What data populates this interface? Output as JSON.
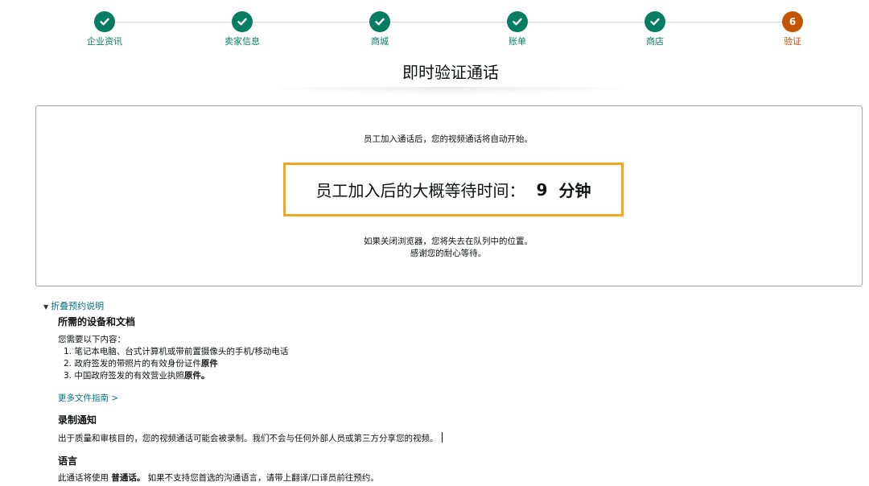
{
  "stepper": {
    "steps": [
      {
        "label": "企业资讯",
        "state": "done"
      },
      {
        "label": "卖家信息",
        "state": "done"
      },
      {
        "label": "商城",
        "state": "done"
      },
      {
        "label": "账单",
        "state": "done"
      },
      {
        "label": "商店",
        "state": "done"
      },
      {
        "label": "验证",
        "state": "current",
        "number": "6"
      }
    ]
  },
  "page_title": "即时验证通话",
  "wait_box": {
    "auto_start_text": "员工加入通话后，您的视频通话将自动开始。",
    "wait_label": "员工加入后的大概等待时间：",
    "wait_minutes": "9",
    "wait_unit": "分钟",
    "note_line1": "如果关闭浏览器，您将失去在队列中的位置。",
    "note_line2": "感谢您的耐心等待。"
  },
  "instructions": {
    "toggle_label": "折叠预约说明",
    "equipment": {
      "heading": "所需的设备和文档",
      "intro": "您需要以下内容：",
      "items": [
        {
          "text": "1. 笔记本电脑、台式计算机或带前置摄像头的手机/移动电话",
          "bold": ""
        },
        {
          "text": "2. 政府签发的带照片的有效身份证件",
          "bold": "原件"
        },
        {
          "text": "3. 中国政府签发的有效营业执照",
          "bold": "原件。"
        }
      ],
      "more_link": "更多文件指南 >"
    },
    "recording": {
      "heading": "录制通知",
      "text": "出于质量和审核目的，您的视频通话可能会被录制。我们不会与任何外部人员或第三方分享您的视频。"
    },
    "language": {
      "heading": "语言",
      "text_prefix": "此通话将使用 ",
      "text_bold": "普通话。",
      "text_suffix": " 如果不支持您首选的沟通语言，请带上翻译/口译员前往预约。"
    }
  },
  "colors": {
    "step_done": "#067d62",
    "step_current": "#c45500",
    "highlight_border": "#f0a81e",
    "link": "#007185"
  },
  "icons": {
    "step_done": "check-icon",
    "toggle": "caret-down-icon"
  }
}
